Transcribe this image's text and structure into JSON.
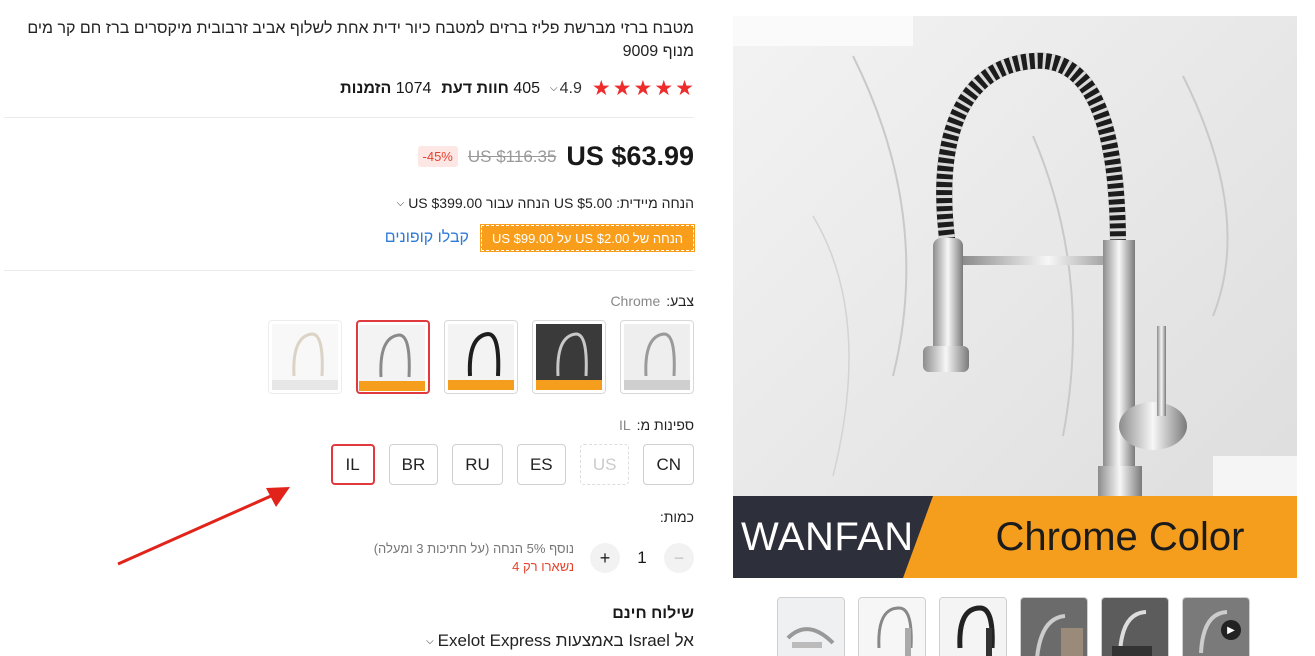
{
  "product": {
    "title": "מטבח ברזי מברשת פליז ברזים למטבח כיור ידית אחת לשלוף אביב זרבובית מיקסרים ברז חם קר מים מנוף 9009",
    "rating": "4.9",
    "reviews_count": "405",
    "reviews_label": "חוות דעת",
    "orders_count": "1074",
    "orders_label": "הזמנות",
    "stars": 5
  },
  "price": {
    "current": "US $63.99",
    "original": "US $116.35",
    "discount": "-45%",
    "instant_discount": "הנחה מיידית: US $5.00 הנחה עבור US $399.00",
    "coupon_tag": "הנחה של US $2.00 על US $99.00",
    "coupon_link": "קבלו קופונים"
  },
  "color": {
    "label": "צבע:",
    "selected": "Chrome",
    "options": [
      {
        "name": "Brushed Nickel A",
        "state": "normal"
      },
      {
        "name": "Brush Nickel Color",
        "state": "normal"
      },
      {
        "name": "Black Color",
        "state": "normal"
      },
      {
        "name": "Chrome Color",
        "state": "selected"
      },
      {
        "name": "Gold Color",
        "state": "disabled"
      }
    ]
  },
  "ships_from": {
    "label": "ספינות מ:",
    "selected": "IL",
    "options": [
      {
        "code": "CN",
        "state": "normal"
      },
      {
        "code": "US",
        "state": "disabled"
      },
      {
        "code": "ES",
        "state": "normal"
      },
      {
        "code": "RU",
        "state": "normal"
      },
      {
        "code": "BR",
        "state": "normal"
      },
      {
        "code": "IL",
        "state": "selected"
      }
    ]
  },
  "quantity": {
    "label": "כמות:",
    "value": "1",
    "extra_discount": "נוסף 5% הנחה (על חתיכות 3 ומעלה)",
    "stock_left": "נשארו רק 4"
  },
  "shipping": {
    "title": "שילוח חינם",
    "via": "אל Israel באמצעות Exelot Express"
  },
  "media": {
    "banner_brand": "WANFAN",
    "banner_color": "Chrome Color",
    "thumbnails": [
      "thumb-1",
      "thumb-2",
      "thumb-3",
      "thumb-4",
      "thumb-5",
      "thumb-6"
    ],
    "video_badge": "▶"
  },
  "colors": {
    "accent_red": "#e0393e",
    "coupon_orange": "#f89e1b",
    "link_blue": "#2f7bd8",
    "star_red": "#ee2c2c"
  }
}
